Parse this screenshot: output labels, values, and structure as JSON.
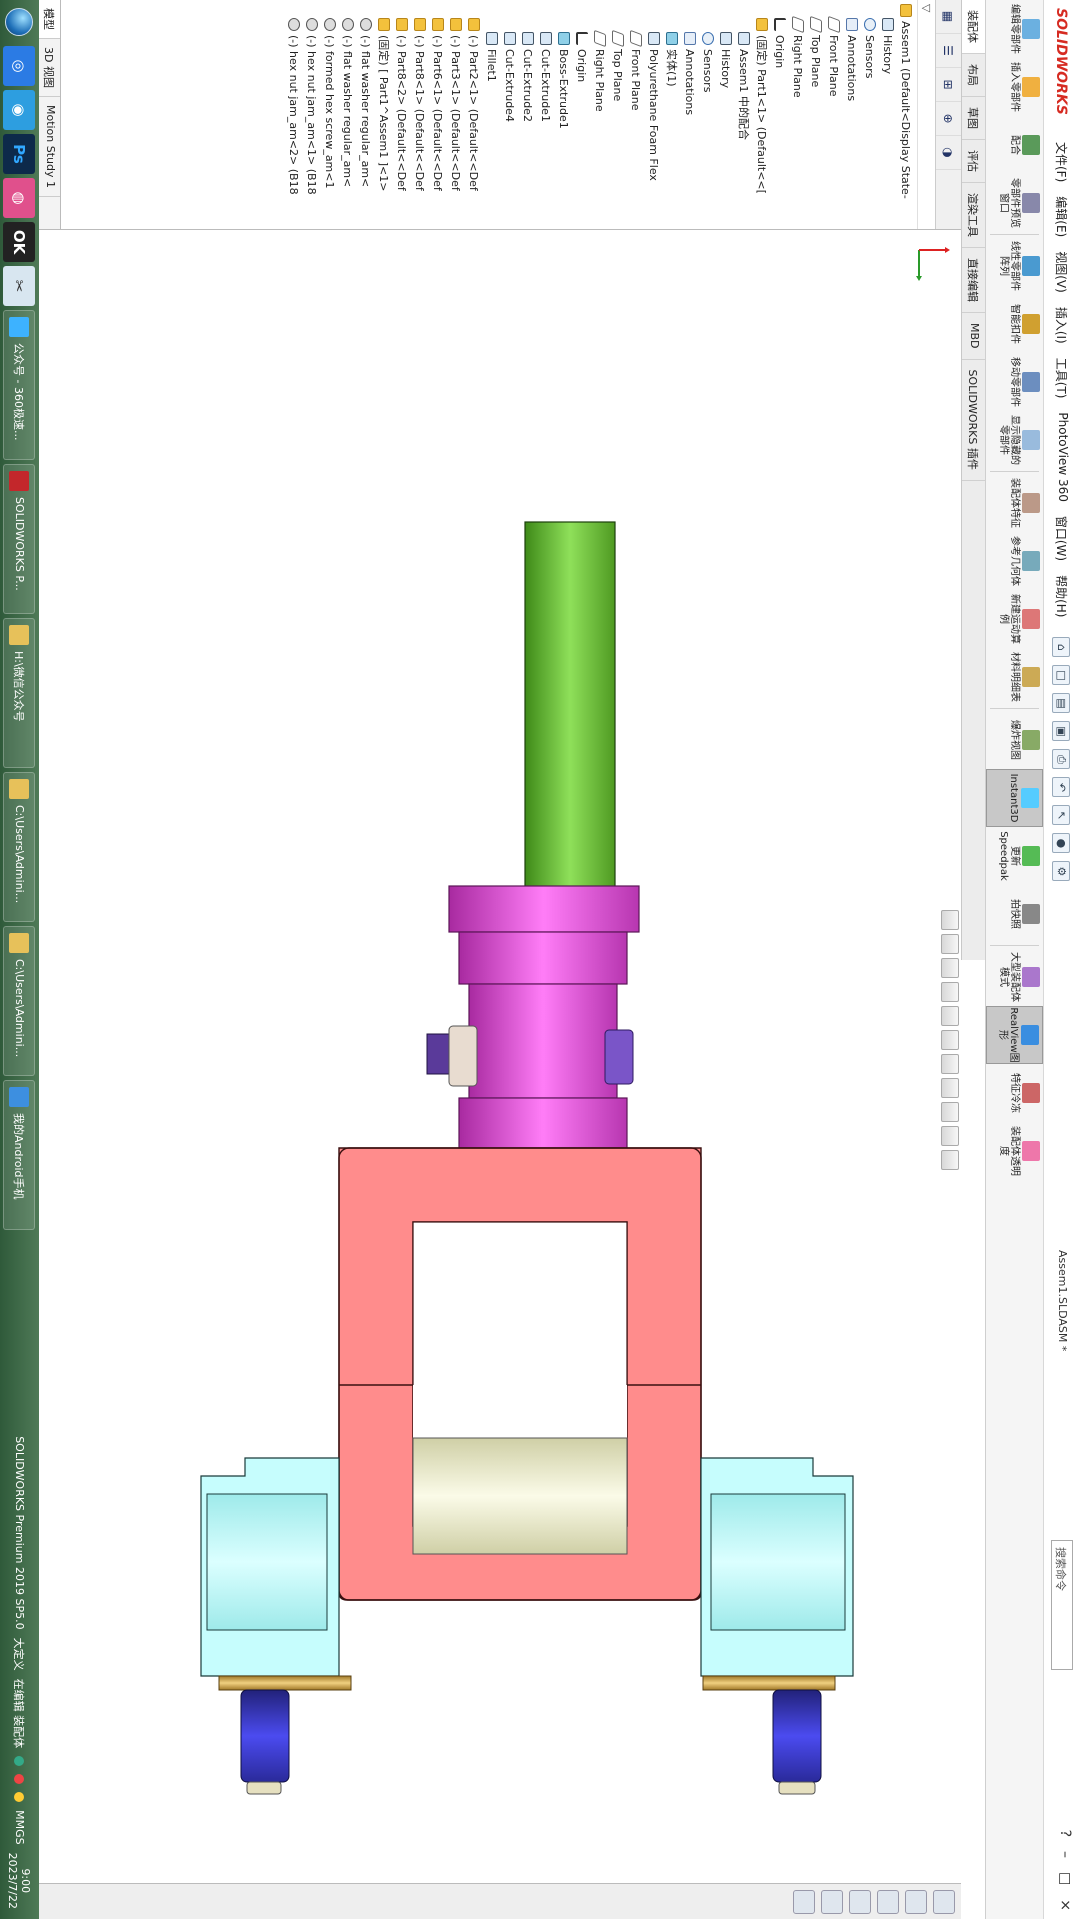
{
  "titlebar": {
    "brand": "SOLIDWORKS",
    "menu": [
      "文件(F)",
      "编辑(E)",
      "视图(V)",
      "插入(I)",
      "工具(T)",
      "PhotoView 360",
      "窗口(W)",
      "帮助(H)"
    ],
    "document": "Assem1.SLDASM *",
    "search_placeholder": "搜索命令",
    "help": "?"
  },
  "ribbon": {
    "buttons": [
      "编辑零部件",
      "插入零部件",
      "配合",
      "零部件预览窗口",
      "线性零部件阵列",
      "智能扣件",
      "移动零部件",
      "显示隐藏的零部件",
      "装配体特征",
      "参考几何体",
      "新建运动算例",
      "材料明细表",
      "爆炸视图",
      "Instant3D",
      "更新Speedpak",
      "拍快照",
      "大型装配体模式",
      "RealView图形",
      "特征冷冻",
      "装配体透明度"
    ],
    "selected": [
      "Instant3D",
      "RealView图形"
    ]
  },
  "cmd_tabs": [
    "装配体",
    "布局",
    "草图",
    "评估",
    "渲染工具",
    "直接编辑",
    "MBD",
    "SOLIDWORKS 插件"
  ],
  "fm": {
    "filter_icon": "filter-icon",
    "tree": [
      {
        "label": "Assem1  (Default<Display State-",
        "icon": "ico-folder",
        "indent": 0
      },
      {
        "label": "History",
        "icon": "ico-feat",
        "indent": 1
      },
      {
        "label": "Sensors",
        "icon": "ico-sensor",
        "indent": 1
      },
      {
        "label": "Annotations",
        "icon": "ico-ann",
        "indent": 1
      },
      {
        "label": "Front Plane",
        "icon": "ico-plane",
        "indent": 1
      },
      {
        "label": "Top Plane",
        "icon": "ico-plane",
        "indent": 1
      },
      {
        "label": "Right Plane",
        "icon": "ico-plane",
        "indent": 1
      },
      {
        "label": "Origin",
        "icon": "ico-origin",
        "indent": 1
      },
      {
        "label": "(固定) Part1<1> (Default<<[",
        "icon": "ico-folder",
        "indent": 1
      },
      {
        "label": "Assem1 中的配合",
        "icon": "ico-feat",
        "indent": 2
      },
      {
        "label": "History",
        "icon": "ico-feat",
        "indent": 2
      },
      {
        "label": "Sensors",
        "icon": "ico-sensor",
        "indent": 2
      },
      {
        "label": "Annotations",
        "icon": "ico-ann",
        "indent": 2
      },
      {
        "label": "实体(1)",
        "icon": "ico-part",
        "indent": 2
      },
      {
        "label": "Polyurethane Foam Flex",
        "icon": "ico-feat",
        "indent": 2
      },
      {
        "label": "Front Plane",
        "icon": "ico-plane",
        "indent": 2
      },
      {
        "label": "Top Plane",
        "icon": "ico-plane",
        "indent": 2
      },
      {
        "label": "Right Plane",
        "icon": "ico-plane",
        "indent": 2
      },
      {
        "label": "Origin",
        "icon": "ico-origin",
        "indent": 2
      },
      {
        "label": "Boss-Extrude1",
        "icon": "ico-part",
        "indent": 2
      },
      {
        "label": "Cut-Extrude1",
        "icon": "ico-feat",
        "indent": 2
      },
      {
        "label": "Cut-Extrude2",
        "icon": "ico-feat",
        "indent": 2
      },
      {
        "label": "Cut-Extrude4",
        "icon": "ico-feat",
        "indent": 2
      },
      {
        "label": "Fillet1",
        "icon": "ico-feat",
        "indent": 2
      },
      {
        "label": "(-) Part2<1> (Default<<Def",
        "icon": "ico-folder",
        "indent": 1
      },
      {
        "label": "(-) Part3<1> (Default<<Def",
        "icon": "ico-folder",
        "indent": 1
      },
      {
        "label": "(-) Part6<1> (Default<<Def",
        "icon": "ico-folder",
        "indent": 1
      },
      {
        "label": "(-) Part8<1> (Default<<Def",
        "icon": "ico-folder",
        "indent": 1
      },
      {
        "label": "(-) Part8<2> (Default<<Def",
        "icon": "ico-folder",
        "indent": 1
      },
      {
        "label": "(固定) [ Part1^Assem1 ]<1>",
        "icon": "ico-folder",
        "indent": 1
      },
      {
        "label": "(-) flat washer regular_am<",
        "icon": "ico-screw",
        "indent": 1
      },
      {
        "label": "(-) flat washer regular_am<",
        "icon": "ico-screw",
        "indent": 1
      },
      {
        "label": "(-) formed hex screw_am<1",
        "icon": "ico-screw",
        "indent": 1
      },
      {
        "label": "(-) hex nut jam_am<1> (B18",
        "icon": "ico-screw",
        "indent": 1
      },
      {
        "label": "(-) hex nut jam_am<2> (B18",
        "icon": "ico-screw",
        "indent": 1
      }
    ],
    "bottom_tabs": [
      "模型",
      "3D 视图",
      "Motion Study 1"
    ]
  },
  "taskbar": {
    "tasks": [
      "公众号 - 360极速...",
      "SOLIDWORKS P...",
      "H:\\微信公众号",
      "C:\\Users\\Admini...",
      "C:\\Users\\Admini...",
      "我的Android手机"
    ],
    "status_left": "SOLIDWORKS Premium 2019 SP5.0",
    "status_mid": [
      "大定义",
      "在编辑 装配体"
    ],
    "units": "MMGS",
    "time": "9:00",
    "date": "2023/7/22"
  },
  "colors": {
    "clevis": "#ff8c8c",
    "bracket": "#c6fdfd",
    "shaft": "#f2f2d2",
    "nut": "#3b3bd2",
    "washer": "#c8a040",
    "hub": "#e65be0",
    "rod": "#6ec03a"
  }
}
